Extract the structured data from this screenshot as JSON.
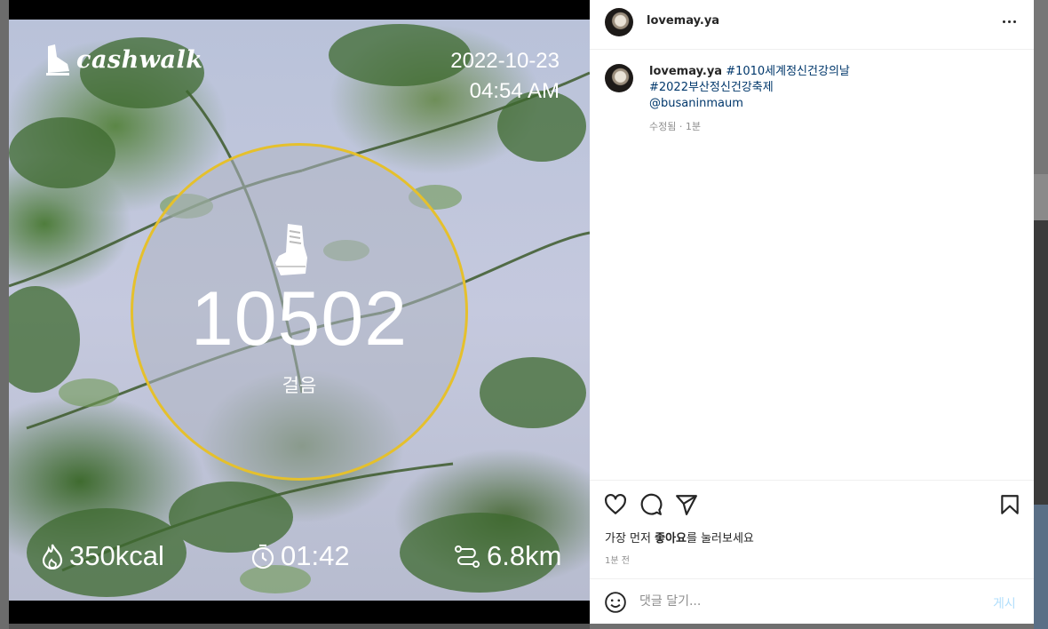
{
  "photo": {
    "brand": "cashwalk",
    "date": "2022-10-23",
    "time": "04:54 AM",
    "steps": "10502",
    "steps_label": "걸음",
    "calories": "350kcal",
    "duration": "01:42",
    "distance": "6.8km",
    "ring_color": "#e5c02c"
  },
  "header": {
    "username": "lovemay.ya",
    "more_icon": "more-horizontal-icon"
  },
  "caption": {
    "username": "lovemay.ya",
    "hashtag1": "#1010세계정신건강의날",
    "hashtag2": "#2022부산정신건강축제",
    "mention": "@busaninmaum",
    "meta": "수정됨 · 1분"
  },
  "actions": {
    "icons": [
      "heart-icon",
      "comment-icon",
      "share-icon",
      "bookmark-icon"
    ],
    "likes_prefix": "가장 먼저 ",
    "likes_bold": "좋아요",
    "likes_suffix": "를 눌러보세요",
    "time_ago": "1분 전"
  },
  "comment": {
    "placeholder": "댓글 달기...",
    "post_label": "게시",
    "post_color": "#b2dffc"
  }
}
